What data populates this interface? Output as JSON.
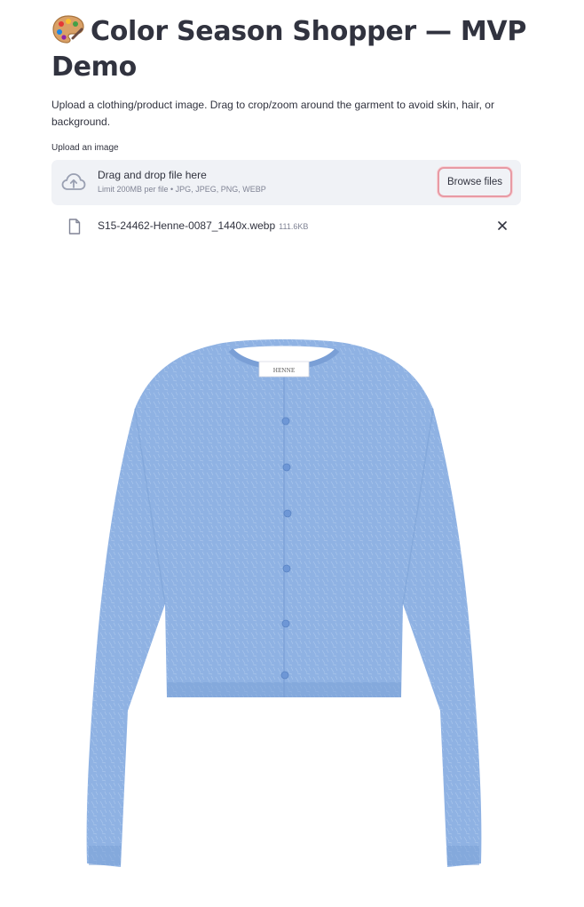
{
  "header": {
    "title": "Color Season Shopper — MVP Demo",
    "title_icon": "artist-palette-emoji"
  },
  "description": "Upload a clothing/product image. Drag to crop/zoom around the garment to avoid skin, hair, or background.",
  "uploader": {
    "label": "Upload an image",
    "drop_text": "Drag and drop file here",
    "limit_text": "Limit 200MB per file • JPG, JPEG, PNG, WEBP",
    "browse_label": "Browse files",
    "icon": "cloud-upload-icon"
  },
  "uploaded_file": {
    "name": "S15-24462-Henne-0087_1440x.webp",
    "size": "111.6KB",
    "icon": "file-icon",
    "remove_icon": "close-icon"
  },
  "preview": {
    "label_text": "HENNE",
    "garment_color": "#8fb2e3",
    "garment_shade": "#7a9fd6",
    "button_color": "#6e97d6"
  },
  "colors": {
    "text": "#31333f",
    "muted": "#808495",
    "dropzone_bg": "#f0f2f6",
    "focus_ring": "#e89aa4"
  }
}
